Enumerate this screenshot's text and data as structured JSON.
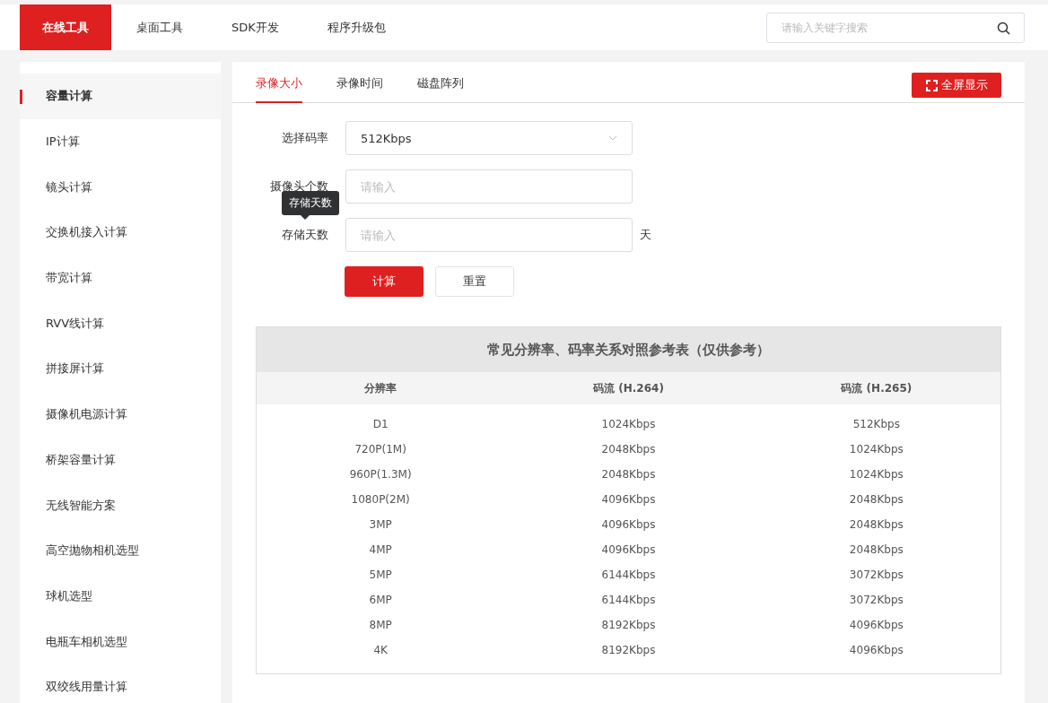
{
  "top_nav": {
    "items": [
      {
        "label": "在线工具",
        "selected": true
      },
      {
        "label": "桌面工具",
        "selected": false
      },
      {
        "label": "SDK开发",
        "selected": false
      },
      {
        "label": "程序升级包",
        "selected": false
      }
    ],
    "search": {
      "placeholder": "请输入关键字搜索"
    }
  },
  "sidebar": {
    "items": [
      {
        "label": "容量计算",
        "selected": true
      },
      {
        "label": "IP计算",
        "selected": false
      },
      {
        "label": "镜头计算",
        "selected": false
      },
      {
        "label": "交换机接入计算",
        "selected": false
      },
      {
        "label": "带宽计算",
        "selected": false
      },
      {
        "label": "RVV线计算",
        "selected": false
      },
      {
        "label": "拼接屏计算",
        "selected": false
      },
      {
        "label": "摄像机电源计算",
        "selected": false
      },
      {
        "label": "桥架容量计算",
        "selected": false
      },
      {
        "label": "无线智能方案",
        "selected": false
      },
      {
        "label": "高空抛物相机选型",
        "selected": false
      },
      {
        "label": "球机选型",
        "selected": false
      },
      {
        "label": "电瓶车相机选型",
        "selected": false
      },
      {
        "label": "双绞线用量计算",
        "selected": false
      }
    ]
  },
  "tabs": [
    {
      "label": "录像大小",
      "selected": true
    },
    {
      "label": "录像时间",
      "selected": false
    },
    {
      "label": "磁盘阵列",
      "selected": false
    }
  ],
  "fullscreen_button": "全屏显示",
  "form": {
    "fields": [
      {
        "kind": "select",
        "label": "选择码率",
        "value": "512Kbps"
      },
      {
        "kind": "input",
        "label": "摄像头个数",
        "placeholder": "请输入"
      },
      {
        "kind": "input",
        "label": "存储天数",
        "placeholder": "请输入",
        "unit": "天"
      }
    ],
    "tooltip": "存储天数",
    "calculate_button": "计算",
    "reset_button": "重置"
  },
  "table": {
    "title": "常见分辨率、码率关系对照参考表（仅供参考）",
    "columns": [
      "分辨率",
      "码流 (H.264)",
      "码流 (H.265)"
    ],
    "rows": [
      [
        "D1",
        "1024Kbps",
        "512Kbps"
      ],
      [
        "720P(1M)",
        "2048Kbps",
        "1024Kbps"
      ],
      [
        "960P(1.3M)",
        "2048Kbps",
        "1024Kbps"
      ],
      [
        "1080P(2M)",
        "4096Kbps",
        "2048Kbps"
      ],
      [
        "3MP",
        "4096Kbps",
        "2048Kbps"
      ],
      [
        "4MP",
        "4096Kbps",
        "2048Kbps"
      ],
      [
        "5MP",
        "6144Kbps",
        "3072Kbps"
      ],
      [
        "6MP",
        "6144Kbps",
        "3072Kbps"
      ],
      [
        "8MP",
        "8192Kbps",
        "4096Kbps"
      ],
      [
        "4K",
        "8192Kbps",
        "4096Kbps"
      ]
    ]
  }
}
